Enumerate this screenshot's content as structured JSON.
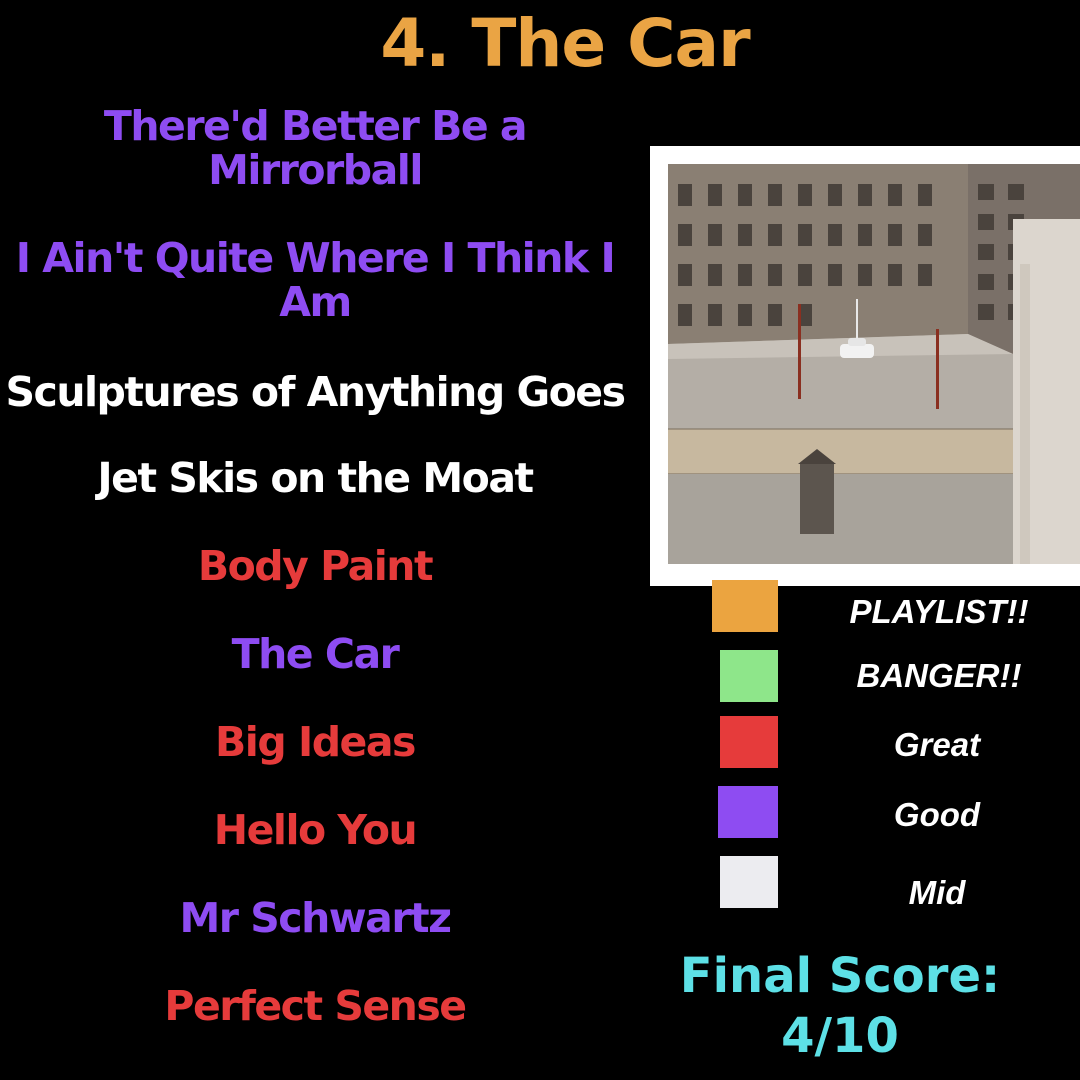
{
  "title": "4. The Car",
  "tracks": [
    {
      "name": "There'd Better Be a Mirrorball",
      "rating": "Good"
    },
    {
      "name": "I Ain't Quite Where I Think I Am",
      "rating": "Good"
    },
    {
      "name": "Sculptures of Anything Goes",
      "rating": "Mid"
    },
    {
      "name": "Jet Skis on the Moat",
      "rating": "Mid"
    },
    {
      "name": "Body Paint",
      "rating": "Great"
    },
    {
      "name": "The Car",
      "rating": "Good"
    },
    {
      "name": "Big Ideas",
      "rating": "Great"
    },
    {
      "name": "Hello You",
      "rating": "Great"
    },
    {
      "name": "Mr Schwartz",
      "rating": "Good"
    },
    {
      "name": "Perfect Sense",
      "rating": "Great"
    }
  ],
  "legend": [
    {
      "label": "PLAYLIST!!",
      "color": "#eba440"
    },
    {
      "label": "BANGER!!",
      "color": "#8ee68a"
    },
    {
      "label": "Great",
      "color": "#e63b3b"
    },
    {
      "label": "Good",
      "color": "#8e4cf2"
    },
    {
      "label": "Mid",
      "color": "#ececf0"
    }
  ],
  "final_score": {
    "label": "Final Score:",
    "value": "4/10"
  },
  "colors": {
    "title": "#eaa444",
    "final_score": "#5de0e6",
    "background": "#000000"
  },
  "icons": {
    "album_cover": "album-cover-image"
  }
}
